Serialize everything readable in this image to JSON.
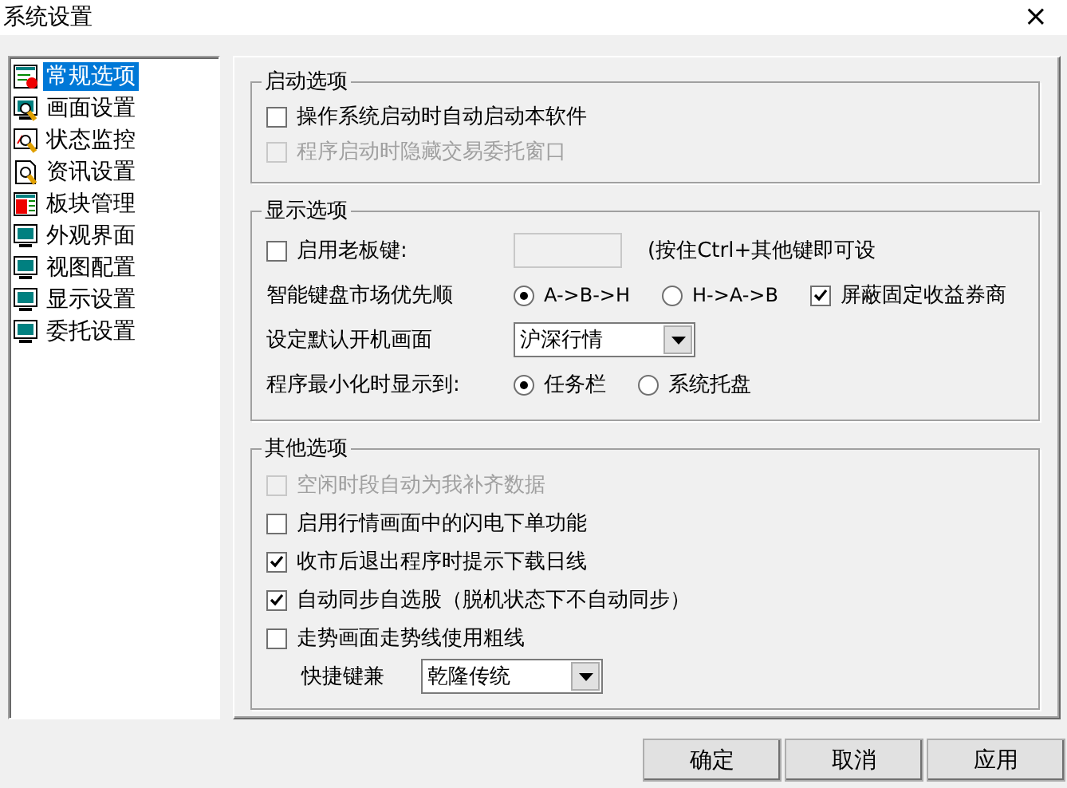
{
  "window": {
    "title": "系统设置",
    "close": "×"
  },
  "sidebar": {
    "items": [
      {
        "label": "常规选项",
        "kind": "form",
        "selected": true
      },
      {
        "label": "画面设置",
        "kind": "zoom",
        "selected": false
      },
      {
        "label": "状态监控",
        "kind": "chart",
        "selected": false
      },
      {
        "label": "资讯设置",
        "kind": "doc",
        "selected": false
      },
      {
        "label": "板块管理",
        "kind": "board",
        "selected": false
      },
      {
        "label": "外观界面",
        "kind": "screen",
        "selected": false
      },
      {
        "label": "视图配置",
        "kind": "screen",
        "selected": false
      },
      {
        "label": "显示设置",
        "kind": "screen",
        "selected": false
      },
      {
        "label": "委托设置",
        "kind": "screen",
        "selected": false
      }
    ]
  },
  "groups": [
    {
      "title": "启动选项",
      "kind": "tight",
      "rows": [
        {
          "kind": "checkbox",
          "label": "操作系统启动时自动启动本软件",
          "checked": false,
          "disabled": false
        },
        {
          "kind": "checkbox",
          "label": "程序启动时隐藏交易委托窗口",
          "checked": false,
          "disabled": true
        }
      ]
    },
    {
      "title": "显示选项",
      "kind": "loose",
      "rows": [
        {
          "kind": "hotkey",
          "label": "启用老板键:",
          "checked": false,
          "hint": "(按住Ctrl+其他键即可设"
        },
        {
          "kind": "radio",
          "label": "智能键盘市场优先顺",
          "options": [
            {
              "label": "A->B->H",
              "selected": true
            },
            {
              "label": "H->A->B",
              "selected": false
            }
          ],
          "extra": {
            "label": "屏蔽固定收益券商",
            "checked": true
          }
        },
        {
          "kind": "select",
          "label": "设定默认开机画面",
          "value": "沪深行情",
          "indent": false
        },
        {
          "kind": "radio",
          "label": "程序最小化时显示到:",
          "options": [
            {
              "label": "任务栏",
              "selected": true
            },
            {
              "label": "系统托盘",
              "selected": false
            }
          ]
        }
      ]
    },
    {
      "title": "其他选项",
      "kind": "medium",
      "rows": [
        {
          "kind": "checkbox",
          "label": "空闲时段自动为我补齐数据",
          "checked": false,
          "disabled": true
        },
        {
          "kind": "checkbox",
          "label": "启用行情画面中的闪电下单功能",
          "checked": false,
          "disabled": false
        },
        {
          "kind": "checkbox",
          "label": "收市后退出程序时提示下载日线",
          "checked": true,
          "disabled": false
        },
        {
          "kind": "checkbox",
          "label": "自动同步自选股（脱机状态下不自动同步）",
          "checked": true,
          "disabled": false
        },
        {
          "kind": "checkbox",
          "label": "走势画面走势线使用粗线",
          "checked": false,
          "disabled": false
        },
        {
          "kind": "select",
          "label": "快捷键兼",
          "value": "乾隆传统",
          "indent": true
        }
      ]
    }
  ],
  "buttons": [
    "确定",
    "取消",
    "应用"
  ]
}
